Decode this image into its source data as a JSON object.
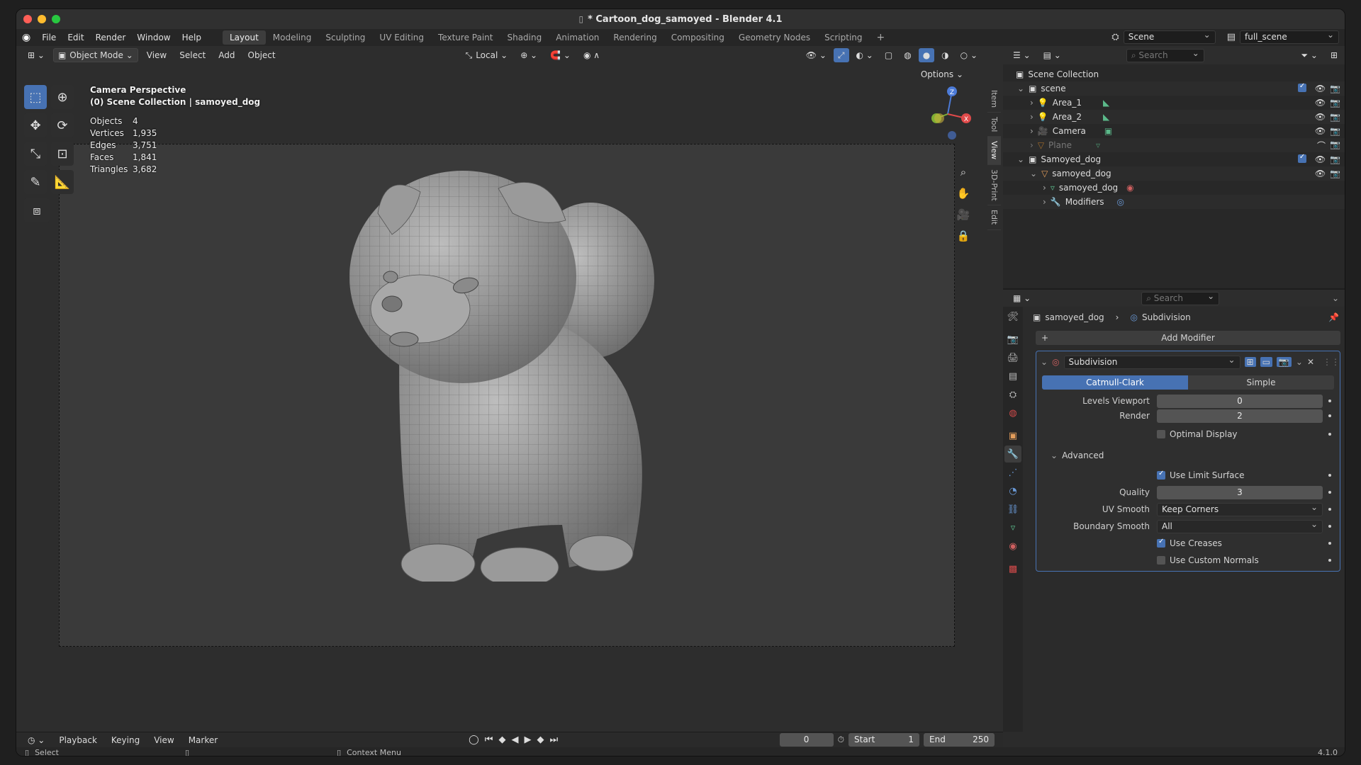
{
  "window": {
    "title": "* Cartoon_dog_samoyed - Blender 4.1",
    "version": "4.1.0"
  },
  "menu": {
    "items": [
      "File",
      "Edit",
      "Render",
      "Window",
      "Help"
    ],
    "workspaces": [
      "Layout",
      "Modeling",
      "Sculpting",
      "UV Editing",
      "Texture Paint",
      "Shading",
      "Animation",
      "Rendering",
      "Compositing",
      "Geometry Nodes",
      "Scripting"
    ],
    "active_workspace": "Layout",
    "scene_name": "Scene",
    "view_layer": "full_scene"
  },
  "viewport": {
    "mode": "Object Mode",
    "menus": [
      "View",
      "Select",
      "Add",
      "Object"
    ],
    "transform_orientation": "Local",
    "options_label": "Options",
    "overlay_title": "Camera Perspective",
    "overlay_subtitle": "(0) Scene Collection | samoyed_dog",
    "stats": [
      {
        "label": "Objects",
        "value": "4"
      },
      {
        "label": "Vertices",
        "value": "1,935"
      },
      {
        "label": "Edges",
        "value": "3,751"
      },
      {
        "label": "Faces",
        "value": "1,841"
      },
      {
        "label": "Triangles",
        "value": "3,682"
      }
    ],
    "side_tabs": [
      "Item",
      "Tool",
      "View",
      "3D-Print",
      "Edit"
    ],
    "active_side_tab": "View",
    "gizmo": {
      "z": "Z",
      "x": "X"
    }
  },
  "outliner": {
    "search_placeholder": "Search",
    "rows": [
      {
        "label": "Scene Collection",
        "indent": 0,
        "icon": "collection-icon"
      },
      {
        "label": "scene",
        "indent": 1,
        "icon": "collection-icon",
        "checkbox": true
      },
      {
        "label": "Area_1",
        "indent": 2,
        "icon": "light-icon"
      },
      {
        "label": "Area_2",
        "indent": 2,
        "icon": "light-icon"
      },
      {
        "label": "Camera",
        "indent": 2,
        "icon": "camera-icon"
      },
      {
        "label": "Plane",
        "indent": 2,
        "icon": "mesh-icon",
        "dim": true
      },
      {
        "label": "Samoyed_dog",
        "indent": 1,
        "icon": "collection-icon",
        "checkbox": true
      },
      {
        "label": "samoyed_dog",
        "indent": 2,
        "icon": "mesh-icon"
      },
      {
        "label": "samoyed_dog",
        "indent": 3,
        "icon": "mesh-data-icon"
      },
      {
        "label": "Modifiers",
        "indent": 3,
        "icon": "wrench-icon"
      }
    ]
  },
  "properties": {
    "search_placeholder": "Search",
    "breadcrumb_object": "samoyed_dog",
    "breadcrumb_modifier": "Subdivision",
    "add_modifier": "Add Modifier",
    "modifier_name": "Subdivision",
    "algo_tabs": [
      "Catmull-Clark",
      "Simple"
    ],
    "active_algo": "Catmull-Clark",
    "levels_viewport_label": "Levels Viewport",
    "levels_viewport": "0",
    "render_label": "Render",
    "render_levels": "2",
    "optimal_display_label": "Optimal Display",
    "optimal_display": false,
    "advanced_label": "Advanced",
    "use_limit_surface_label": "Use Limit Surface",
    "use_limit_surface": true,
    "quality_label": "Quality",
    "quality": "3",
    "uv_smooth_label": "UV Smooth",
    "uv_smooth": "Keep Corners",
    "boundary_smooth_label": "Boundary Smooth",
    "boundary_smooth": "All",
    "use_creases_label": "Use Creases",
    "use_creases": true,
    "use_custom_normals_label": "Use Custom Normals",
    "use_custom_normals": false
  },
  "timeline": {
    "menus": [
      "Playback",
      "Keying",
      "View",
      "Marker"
    ],
    "current_frame": "0",
    "start_label": "Start",
    "start": "1",
    "end_label": "End",
    "end": "250"
  },
  "statusbar": {
    "select": "Select",
    "context_menu": "Context Menu"
  },
  "colors": {
    "accent": "#4772b3",
    "bg": "#2b2b2b",
    "viewport": "#3a3a3a"
  }
}
